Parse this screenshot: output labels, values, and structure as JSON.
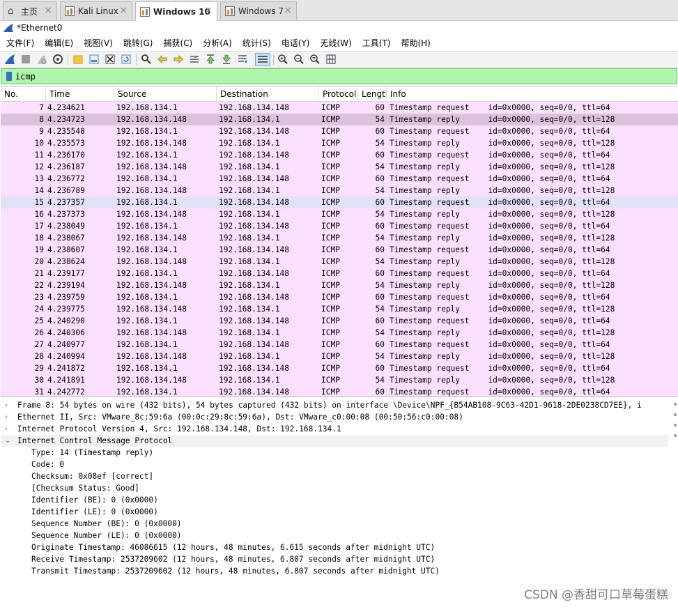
{
  "vm_tabs": [
    {
      "label": "主页"
    },
    {
      "label": "Kali Linux"
    },
    {
      "label": "Windows 10"
    },
    {
      "label": "Windows 7"
    }
  ],
  "tab_close_glyph": "×",
  "window_title": "*Ethernet0",
  "menu": [
    "文件(F)",
    "编辑(E)",
    "视图(V)",
    "跳转(G)",
    "捕获(C)",
    "分析(A)",
    "统计(S)",
    "电话(Y)",
    "无线(W)",
    "工具(T)",
    "帮助(H)"
  ],
  "filter": {
    "value": "icmp"
  },
  "columns": [
    "No.",
    "Time",
    "Source",
    "Destination",
    "Protocol",
    "Lengtl",
    "Info"
  ],
  "packets": [
    {
      "no": "7",
      "time": "4.234621",
      "src": "192.168.134.1",
      "dst": "192.168.134.148",
      "proto": "ICMP",
      "len": "60",
      "info": "Timestamp request    id=0x0000, seq=0/0, ttl=64"
    },
    {
      "no": "8",
      "time": "4.234723",
      "src": "192.168.134.148",
      "dst": "192.168.134.1",
      "proto": "ICMP",
      "len": "54",
      "info": "Timestamp reply      id=0x0000, seq=0/0, ttl=128"
    },
    {
      "no": "9",
      "time": "4.235548",
      "src": "192.168.134.1",
      "dst": "192.168.134.148",
      "proto": "ICMP",
      "len": "60",
      "info": "Timestamp request    id=0x0000, seq=0/0, ttl=64"
    },
    {
      "no": "10",
      "time": "4.235573",
      "src": "192.168.134.148",
      "dst": "192.168.134.1",
      "proto": "ICMP",
      "len": "54",
      "info": "Timestamp reply      id=0x0000, seq=0/0, ttl=128"
    },
    {
      "no": "11",
      "time": "4.236170",
      "src": "192.168.134.1",
      "dst": "192.168.134.148",
      "proto": "ICMP",
      "len": "60",
      "info": "Timestamp request    id=0x0000, seq=0/0, ttl=64"
    },
    {
      "no": "12",
      "time": "4.236187",
      "src": "192.168.134.148",
      "dst": "192.168.134.1",
      "proto": "ICMP",
      "len": "54",
      "info": "Timestamp reply      id=0x0000, seq=0/0, ttl=128"
    },
    {
      "no": "13",
      "time": "4.236772",
      "src": "192.168.134.1",
      "dst": "192.168.134.148",
      "proto": "ICMP",
      "len": "60",
      "info": "Timestamp request    id=0x0000, seq=0/0, ttl=64"
    },
    {
      "no": "14",
      "time": "4.236789",
      "src": "192.168.134.148",
      "dst": "192.168.134.1",
      "proto": "ICMP",
      "len": "54",
      "info": "Timestamp reply      id=0x0000, seq=0/0, ttl=128"
    },
    {
      "no": "15",
      "time": "4.237357",
      "src": "192.168.134.1",
      "dst": "192.168.134.148",
      "proto": "ICMP",
      "len": "60",
      "info": "Timestamp request    id=0x0000, seq=0/0, ttl=64"
    },
    {
      "no": "16",
      "time": "4.237373",
      "src": "192.168.134.148",
      "dst": "192.168.134.1",
      "proto": "ICMP",
      "len": "54",
      "info": "Timestamp reply      id=0x0000, seq=0/0, ttl=128"
    },
    {
      "no": "17",
      "time": "4.238049",
      "src": "192.168.134.1",
      "dst": "192.168.134.148",
      "proto": "ICMP",
      "len": "60",
      "info": "Timestamp request    id=0x0000, seq=0/0, ttl=64"
    },
    {
      "no": "18",
      "time": "4.238067",
      "src": "192.168.134.148",
      "dst": "192.168.134.1",
      "proto": "ICMP",
      "len": "54",
      "info": "Timestamp reply      id=0x0000, seq=0/0, ttl=128"
    },
    {
      "no": "19",
      "time": "4.238607",
      "src": "192.168.134.1",
      "dst": "192.168.134.148",
      "proto": "ICMP",
      "len": "60",
      "info": "Timestamp request    id=0x0000, seq=0/0, ttl=64"
    },
    {
      "no": "20",
      "time": "4.238624",
      "src": "192.168.134.148",
      "dst": "192.168.134.1",
      "proto": "ICMP",
      "len": "54",
      "info": "Timestamp reply      id=0x0000, seq=0/0, ttl=128"
    },
    {
      "no": "21",
      "time": "4.239177",
      "src": "192.168.134.1",
      "dst": "192.168.134.148",
      "proto": "ICMP",
      "len": "60",
      "info": "Timestamp request    id=0x0000, seq=0/0, ttl=64"
    },
    {
      "no": "22",
      "time": "4.239194",
      "src": "192.168.134.148",
      "dst": "192.168.134.1",
      "proto": "ICMP",
      "len": "54",
      "info": "Timestamp reply      id=0x0000, seq=0/0, ttl=128"
    },
    {
      "no": "23",
      "time": "4.239759",
      "src": "192.168.134.1",
      "dst": "192.168.134.148",
      "proto": "ICMP",
      "len": "60",
      "info": "Timestamp request    id=0x0000, seq=0/0, ttl=64"
    },
    {
      "no": "24",
      "time": "4.239775",
      "src": "192.168.134.148",
      "dst": "192.168.134.1",
      "proto": "ICMP",
      "len": "54",
      "info": "Timestamp reply      id=0x0000, seq=0/0, ttl=128"
    },
    {
      "no": "25",
      "time": "4.240290",
      "src": "192.168.134.1",
      "dst": "192.168.134.148",
      "proto": "ICMP",
      "len": "60",
      "info": "Timestamp request    id=0x0000, seq=0/0, ttl=64"
    },
    {
      "no": "26",
      "time": "4.240306",
      "src": "192.168.134.148",
      "dst": "192.168.134.1",
      "proto": "ICMP",
      "len": "54",
      "info": "Timestamp reply      id=0x0000, seq=0/0, ttl=128"
    },
    {
      "no": "27",
      "time": "4.240977",
      "src": "192.168.134.1",
      "dst": "192.168.134.148",
      "proto": "ICMP",
      "len": "60",
      "info": "Timestamp request    id=0x0000, seq=0/0, ttl=64"
    },
    {
      "no": "28",
      "time": "4.240994",
      "src": "192.168.134.148",
      "dst": "192.168.134.1",
      "proto": "ICMP",
      "len": "54",
      "info": "Timestamp reply      id=0x0000, seq=0/0, ttl=128"
    },
    {
      "no": "29",
      "time": "4.241872",
      "src": "192.168.134.1",
      "dst": "192.168.134.148",
      "proto": "ICMP",
      "len": "60",
      "info": "Timestamp request    id=0x0000, seq=0/0, ttl=64"
    },
    {
      "no": "30",
      "time": "4.241891",
      "src": "192.168.134.148",
      "dst": "192.168.134.1",
      "proto": "ICMP",
      "len": "54",
      "info": "Timestamp reply      id=0x0000, seq=0/0, ttl=128"
    },
    {
      "no": "31",
      "time": "4.242772",
      "src": "192.168.134.1",
      "dst": "192.168.134.148",
      "proto": "ICMP",
      "len": "60",
      "info": "Timestamp request    id=0x0000, seq=0/0, ttl=64"
    }
  ],
  "selected_packet": "8",
  "hovered_packet": "15",
  "details": [
    {
      "text": "Frame 8: 54 bytes on wire (432 bits), 54 bytes captured (432 bits) on interface \\Device\\NPF_{B54AB108-9C63-42D1-9618-2DE0238CD7EE}, i",
      "expanded": false
    },
    {
      "text": "Ethernet II, Src: VMware_8c:59:6a (00:0c:29:8c:59:6a), Dst: VMware_c0:00:08 (00:50:56:c0:00:08)",
      "expanded": false
    },
    {
      "text": "Internet Protocol Version 4, Src: 192.168.134.148, Dst: 192.168.134.1",
      "expanded": false
    },
    {
      "text": "Internet Control Message Protocol",
      "expanded": true,
      "children": [
        "Type: 14 (Timestamp reply)",
        "Code: 0",
        "Checksum: 0x08ef [correct]",
        "[Checksum Status: Good]",
        "Identifier (BE): 0 (0x0000)",
        "Identifier (LE): 0 (0x0000)",
        "Sequence Number (BE): 0 (0x0000)",
        "Sequence Number (LE): 0 (0x0000)",
        "Originate Timestamp: 46086615 (12 hours, 48 minutes, 6.615 seconds after midnight UTC)",
        "Receive Timestamp: 2537209602 (12 hours, 48 minutes, 6.807 seconds after midnight UTC)",
        "Transmit Timestamp: 2537209602 (12 hours, 48 minutes, 6.807 seconds after midnight UTC)"
      ]
    }
  ],
  "watermark": "CSDN @香甜可口草莓蛋糕",
  "colors": {
    "row_icmp": "#fce0ff",
    "row_selected": "#dcc3db",
    "row_hover": "#e4e0f7",
    "filter_ok": "#aff5ab"
  }
}
